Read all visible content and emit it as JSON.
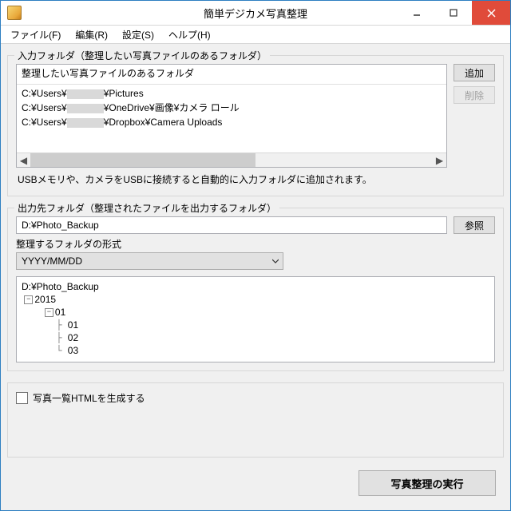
{
  "title": "簡単デジカメ写真整理",
  "menu": {
    "file": "ファイル(F)",
    "edit": "編集(R)",
    "settings": "設定(S)",
    "help": "ヘルプ(H)"
  },
  "input_group": {
    "legend": "入力フォルダ（整理したい写真ファイルのあるフォルダ）",
    "list_header": "整理したい写真ファイルのあるフォルダ",
    "rows": [
      {
        "pre": "C:¥Users¥",
        "post": "¥Pictures",
        "redact_w": 46
      },
      {
        "pre": "C:¥Users¥",
        "post": "¥OneDrive¥画像¥カメラ ロール",
        "redact_w": 46
      },
      {
        "pre": "C:¥Users¥",
        "post": "¥Dropbox¥Camera Uploads",
        "redact_w": 46
      }
    ],
    "add_btn": "追加",
    "del_btn": "削除",
    "tip": "USBメモリや、カメラをUSBに接続すると自動的に入力フォルダに追加されます。"
  },
  "output_group": {
    "legend": "出力先フォルダ（整理されたファイルを出力するフォルダ）",
    "path": "D:¥Photo_Backup",
    "browse_btn": "参照",
    "format_label": "整理するフォルダの形式",
    "format_value": "YYYY/MM/DD",
    "tree": {
      "root": "D:¥Photo_Backup",
      "y": "2015",
      "m": "01",
      "d1": "01",
      "d2": "02",
      "d3": "03"
    }
  },
  "html_group": {
    "checkbox_label": "写真一覧HTMLを生成する"
  },
  "run_btn": "写真整理の実行"
}
